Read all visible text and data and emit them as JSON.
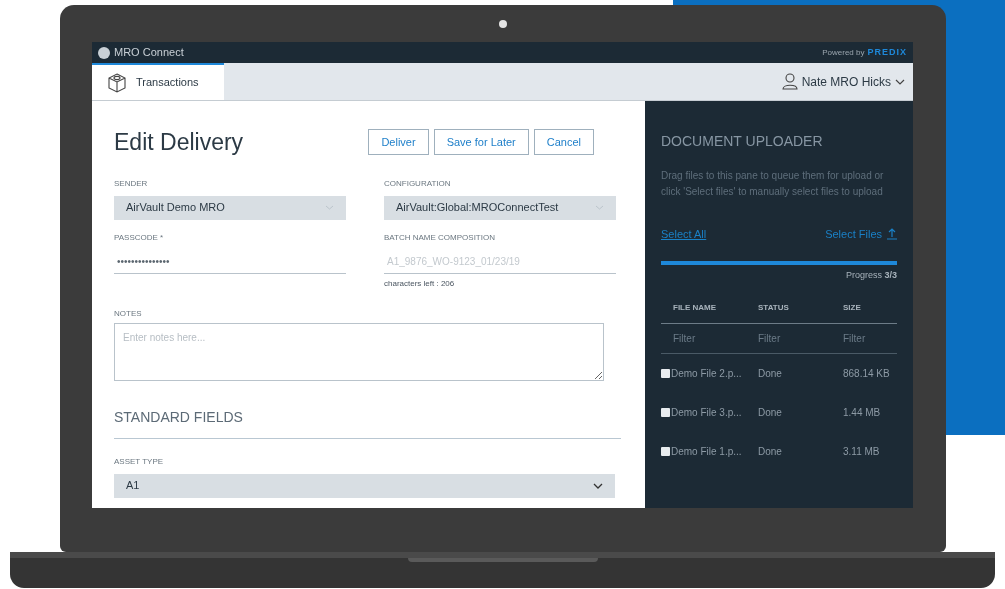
{
  "app": {
    "brand": "MRO Connect",
    "powered_by": "Powered by",
    "platform": "PREDIX"
  },
  "nav": {
    "tabs": [
      {
        "label": "Transactions",
        "selected": true
      }
    ],
    "user": "Nate MRO Hicks"
  },
  "form": {
    "title": "Edit Delivery",
    "buttons": [
      "Deliver",
      "Save for Later",
      "Cancel"
    ],
    "fields": [
      {
        "kind": "select",
        "label": "SENDER",
        "value": "AirVault Demo MRO"
      },
      {
        "kind": "select",
        "label": "CONFIGURATION",
        "value": "AirVault:Global:MROConnectTest"
      },
      {
        "kind": "password",
        "label": "PASSCODE *",
        "value": "•••••••••••••••"
      },
      {
        "kind": "text",
        "label": "BATCH NAME COMPOSITION",
        "placeholder": "A1_9876_WO-9123_01/23/19",
        "hint": "characters left : 206"
      }
    ],
    "notes": {
      "label": "NOTES",
      "placeholder": "Enter notes here..."
    },
    "section": "STANDARD FIELDS",
    "asset_type": {
      "label": "ASSET TYPE",
      "value": "A1"
    }
  },
  "uploader": {
    "title": "DOCUMENT UPLOADER",
    "instructions": "Drag files to this pane to queue them for upload or click 'Select files' to manually select files to upload",
    "select_all": "Select All",
    "select_files": "Select Files",
    "progress": {
      "level": 1,
      "label": "Progress **3/3**"
    },
    "table": {
      "columns": [
        "FILE NAME",
        "STATUS",
        "SIZE"
      ],
      "filters": [
        {
          "placeholder": "Filter"
        },
        {
          "placeholder": "Filter"
        },
        {
          "placeholder": "Filter"
        }
      ],
      "rows": [
        {
          "name": "Demo File 2.p...",
          "status": "Done",
          "size": "868.14 KB",
          "checked": false
        },
        {
          "name": "Demo File 3.p...",
          "status": "Done",
          "size": "1.44 MB",
          "checked": false
        },
        {
          "name": "Demo File 1.p...",
          "status": "Done",
          "size": "3.11 MB",
          "checked": false
        }
      ]
    }
  }
}
